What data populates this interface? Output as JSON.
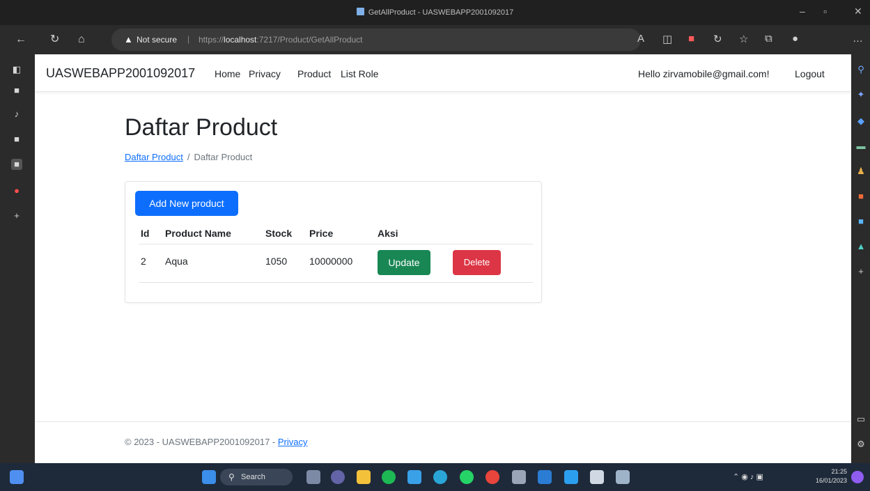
{
  "browser": {
    "window_title": "GetAllProduct - UASWEBAPP2001092017",
    "address": {
      "security_label": "Not secure",
      "url_scheme": "https://",
      "url_host": "localhost",
      "url_rest": ":7217/Product/GetAllProduct"
    }
  },
  "app": {
    "brand": "UASWEBAPP2001092017",
    "nav": {
      "home": "Home",
      "privacy": "Privacy",
      "product": "Product",
      "list_role": "List Role"
    },
    "greeting": "Hello zirvamobile@gmail.com!",
    "logout": "Logout"
  },
  "main": {
    "title": "Daftar Product",
    "breadcrumb": {
      "link": "Daftar Product",
      "separator": "/",
      "current": "Daftar Product"
    },
    "add_button": "Add New product",
    "table": {
      "headers": {
        "id": "Id",
        "name": "Product Name",
        "stock": "Stock",
        "price": "Price",
        "action": "Aksi"
      },
      "rows": [
        {
          "id": "2",
          "name": "Aqua",
          "stock": "1050",
          "price": "10000000",
          "update": "Update",
          "delete": "Delete"
        }
      ]
    }
  },
  "footer": {
    "text": "© 2023 - UASWEBAPP2001092017 -",
    "privacy_link": "Privacy"
  },
  "taskbar": {
    "search_label": "Search",
    "time": "21:25",
    "date": "16/01/2023"
  },
  "colors": {
    "primary": "#0d6efd",
    "success": "#198754",
    "danger": "#dc3545"
  }
}
